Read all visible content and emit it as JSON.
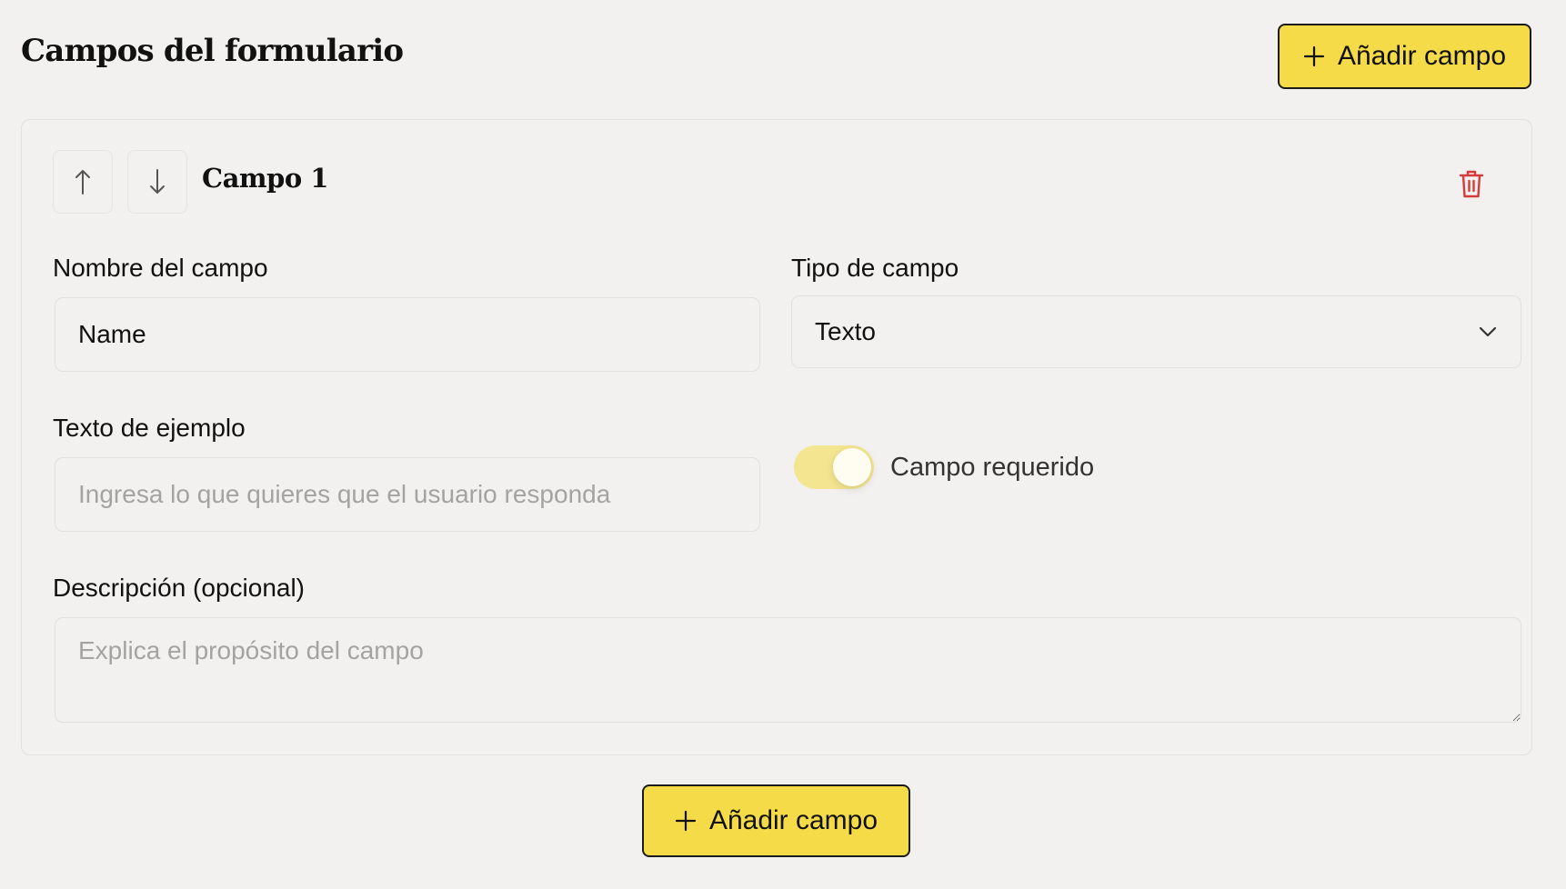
{
  "header": {
    "title": "Campos del formulario",
    "add_button_label": "Añadir campo"
  },
  "field": {
    "title": "Campo 1",
    "name_label": "Nombre del campo",
    "name_value": "Name",
    "type_label": "Tipo de campo",
    "type_value": "Texto",
    "placeholder_label": "Texto de ejemplo",
    "placeholder_hint": "Ingresa lo que quieres que el usuario responda",
    "required_label": "Campo requerido",
    "required_on": true,
    "description_label": "Descripción (opcional)",
    "description_hint": "Explica el propósito del campo"
  },
  "footer": {
    "add_button_label": "Añadir campo"
  },
  "colors": {
    "background": "#f2f1ef",
    "accent": "#f5db48",
    "delete": "#d63a3a",
    "toggle_track": "#f4e590"
  },
  "icons": {
    "add": "plus-icon",
    "move_up": "arrow-up-icon",
    "move_down": "arrow-down-icon",
    "delete": "trash-icon",
    "select": "chevron-down-icon"
  }
}
